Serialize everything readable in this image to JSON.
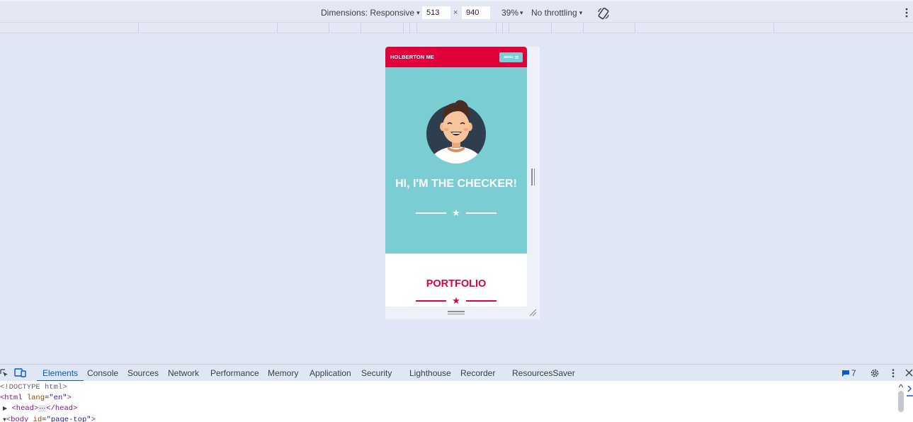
{
  "toolbar": {
    "dimensions_label": "Dimensions: Responsive",
    "width_value": "513",
    "times_sign": "×",
    "height_value": "940",
    "zoom_label": "39%",
    "throttling_label": "No throttling",
    "caret": "▾"
  },
  "device_page": {
    "brand": "HOLBERTON ME",
    "menu_label": "MENU",
    "menu_icon": "hamburger-icon",
    "hero_title": "HI, I'M THE CHECKER!",
    "section_title": "PORTFOLIO",
    "star_glyph": "★",
    "colors": {
      "accent": "#e0003a",
      "hero_bg": "#7acdd2",
      "avatar_bg": "#2e3e4e"
    }
  },
  "devtools": {
    "tabs": [
      "Elements",
      "Console",
      "Sources",
      "Network",
      "Performance",
      "Memory",
      "Application",
      "Security",
      "Lighthouse",
      "Recorder",
      "ResourcesSaver"
    ],
    "active_tab": "Elements",
    "issues_count": "7",
    "code": {
      "doctype": "<!DOCTYPE html>",
      "html_open": "<html",
      "lang_attr": "lang",
      "lang_value": "\"en\"",
      "head_open": "<head>",
      "ellipsis": "⋯",
      "head_close": "</head>",
      "body_open": "<body",
      "id_attr": "id",
      "id_value": "\"page-top\"",
      "tag_end": ">"
    }
  }
}
